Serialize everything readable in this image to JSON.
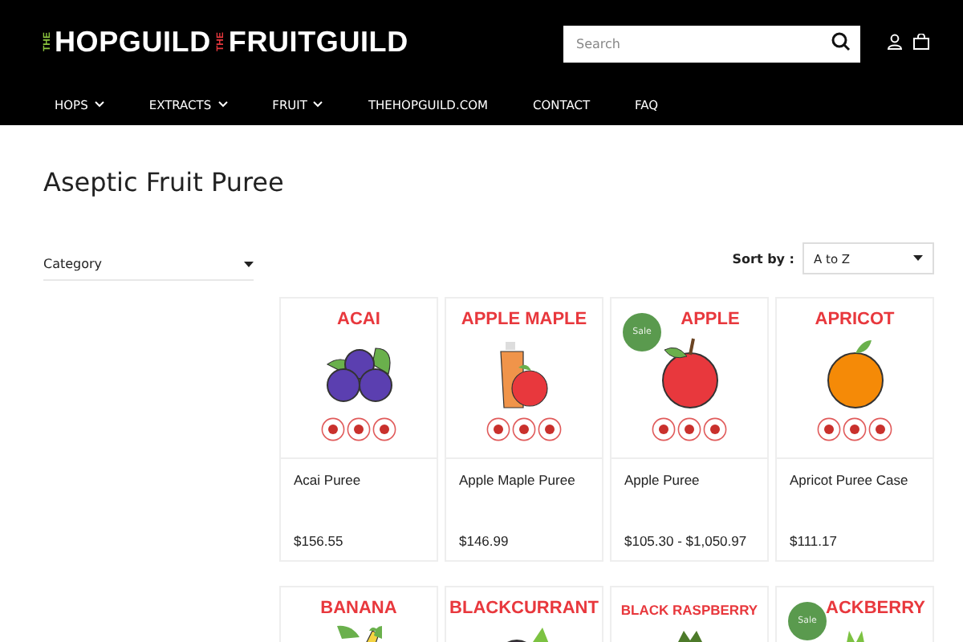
{
  "logo": {
    "prefix_1": "THE",
    "name_1": "HOPGUILD",
    "prefix_2": "THE",
    "name_2": "FRUITGUILD"
  },
  "search": {
    "placeholder": "Search"
  },
  "nav": [
    {
      "label": "HOPS",
      "dropdown": true
    },
    {
      "label": "EXTRACTS",
      "dropdown": true
    },
    {
      "label": "FRUIT",
      "dropdown": true
    },
    {
      "label": "THEHOPGUILD.COM",
      "dropdown": false
    },
    {
      "label": "CONTACT",
      "dropdown": false
    },
    {
      "label": "FAQ",
      "dropdown": false
    }
  ],
  "page_title": "Aseptic Fruit Puree",
  "category_filter": {
    "label": "Category"
  },
  "sort": {
    "label": "Sort by :",
    "value": "A to Z"
  },
  "products": [
    {
      "image_label": "ACAI",
      "kind": "berries",
      "sale": false,
      "name": "Acai Puree",
      "price": "$156.55"
    },
    {
      "image_label": "APPLE MAPLE",
      "kind": "apple-bottle",
      "sale": false,
      "name": "Apple Maple Puree",
      "price": "$146.99"
    },
    {
      "image_label": "APPLE",
      "kind": "apple",
      "sale": true,
      "sale_label": "Sale",
      "name": "Apple Puree",
      "price": "$105.30 - $1,050.97"
    },
    {
      "image_label": "APRICOT",
      "kind": "apricot",
      "sale": false,
      "name": "Apricot Puree Case",
      "price": "$111.17"
    },
    {
      "image_label": "BANANA",
      "kind": "banana",
      "sale": false
    },
    {
      "image_label": "BLACKCURRANT",
      "kind": "blackcurrant",
      "sale": false
    },
    {
      "image_label": "BLACK RASPBERRY",
      "kind": "raspberry",
      "sale": false
    },
    {
      "image_label": "ACKBERRY",
      "kind": "blackberry",
      "sale": true,
      "sale_label": "Sale"
    }
  ]
}
